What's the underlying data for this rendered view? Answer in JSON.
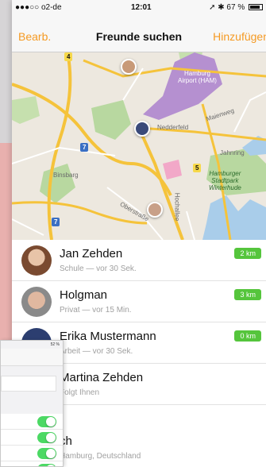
{
  "status_bar": {
    "carrier": "●●●○○ o2-de",
    "time": "12:01",
    "battery": "67 %"
  },
  "nav": {
    "left_button": "Bearb.",
    "title": "Freunde suchen",
    "right_button": "Hinzufügen"
  },
  "map": {
    "labels": {
      "airport_line1": "Hamburg",
      "airport_line2": "Airport (HAM)",
      "nedderfeld": "Nedderfeld",
      "binsbarg": "Binsbarg",
      "oberstrasse": "Oberstraße",
      "jahnring": "Jahnring",
      "maienweg": "Maienweg",
      "hochallee": "Hochallee",
      "park_line1": "Hamburger",
      "park_line2": "Stadtpark",
      "park_line3": "Winterhude"
    },
    "shields": [
      "7",
      "7",
      "7",
      "5",
      "4"
    ]
  },
  "friends": [
    {
      "name": "Jan Zehden",
      "subtitle": "Schule — vor 30 Sek.",
      "distance": "2 km"
    },
    {
      "name": "Holgman",
      "subtitle": "Privat — vor 15 Min.",
      "distance": "3 km"
    },
    {
      "name": "Erika Mustermann",
      "subtitle": "Arbeit — vor 30 Sek.",
      "distance": "0 km"
    },
    {
      "name": "Martina Zehden",
      "subtitle": "Folgt Ihnen",
      "distance": ""
    },
    {
      "name": "ch",
      "subtitle": "Hamburg, Deutschland",
      "distance": ""
    }
  ],
  "overlay": {
    "status": "52 %"
  },
  "colors": {
    "accent": "#f59a23",
    "distance_badge": "#55c53c",
    "toggle_on": "#4cd964"
  }
}
